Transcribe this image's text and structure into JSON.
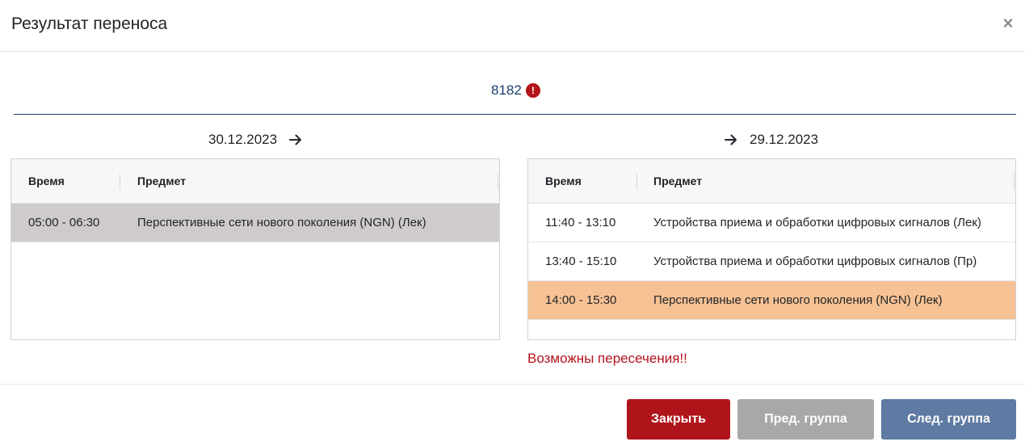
{
  "modal": {
    "title": "Результат переноса",
    "close_symbol": "×"
  },
  "group": {
    "number": "8182",
    "warning_symbol": "!"
  },
  "left": {
    "date": "30.12.2023",
    "columns": {
      "time": "Время",
      "subject": "Предмет"
    },
    "rows": [
      {
        "time": "05:00 - 06:30",
        "subject": "Перспективные сети нового поколения (NGN) (Лек)",
        "highlight": "gray"
      }
    ]
  },
  "right": {
    "date": "29.12.2023",
    "columns": {
      "time": "Время",
      "subject": "Предмет"
    },
    "rows": [
      {
        "time": "11:40 - 13:10",
        "subject": "Устройства приема и обработки цифровых сигналов (Лек)",
        "highlight": "none"
      },
      {
        "time": "13:40 - 15:10",
        "subject": "Устройства приема и обработки цифровых сигналов (Пр)",
        "highlight": "none"
      },
      {
        "time": "14:00 - 15:30",
        "subject": "Перспективные сети нового поколения (NGN) (Лек)",
        "highlight": "orange"
      }
    ],
    "conflict_message": "Возможны пересечения!!"
  },
  "footer": {
    "close_label": "Закрыть",
    "prev_label": "Пред. группа",
    "next_label": "След. группа"
  },
  "colors": {
    "accent_red": "#b0141b",
    "nav_blue": "#5f7aa3",
    "disabled_gray": "#a8a8a8",
    "highlight_orange": "#f7c293",
    "highlight_gray": "#cfcbcb"
  }
}
